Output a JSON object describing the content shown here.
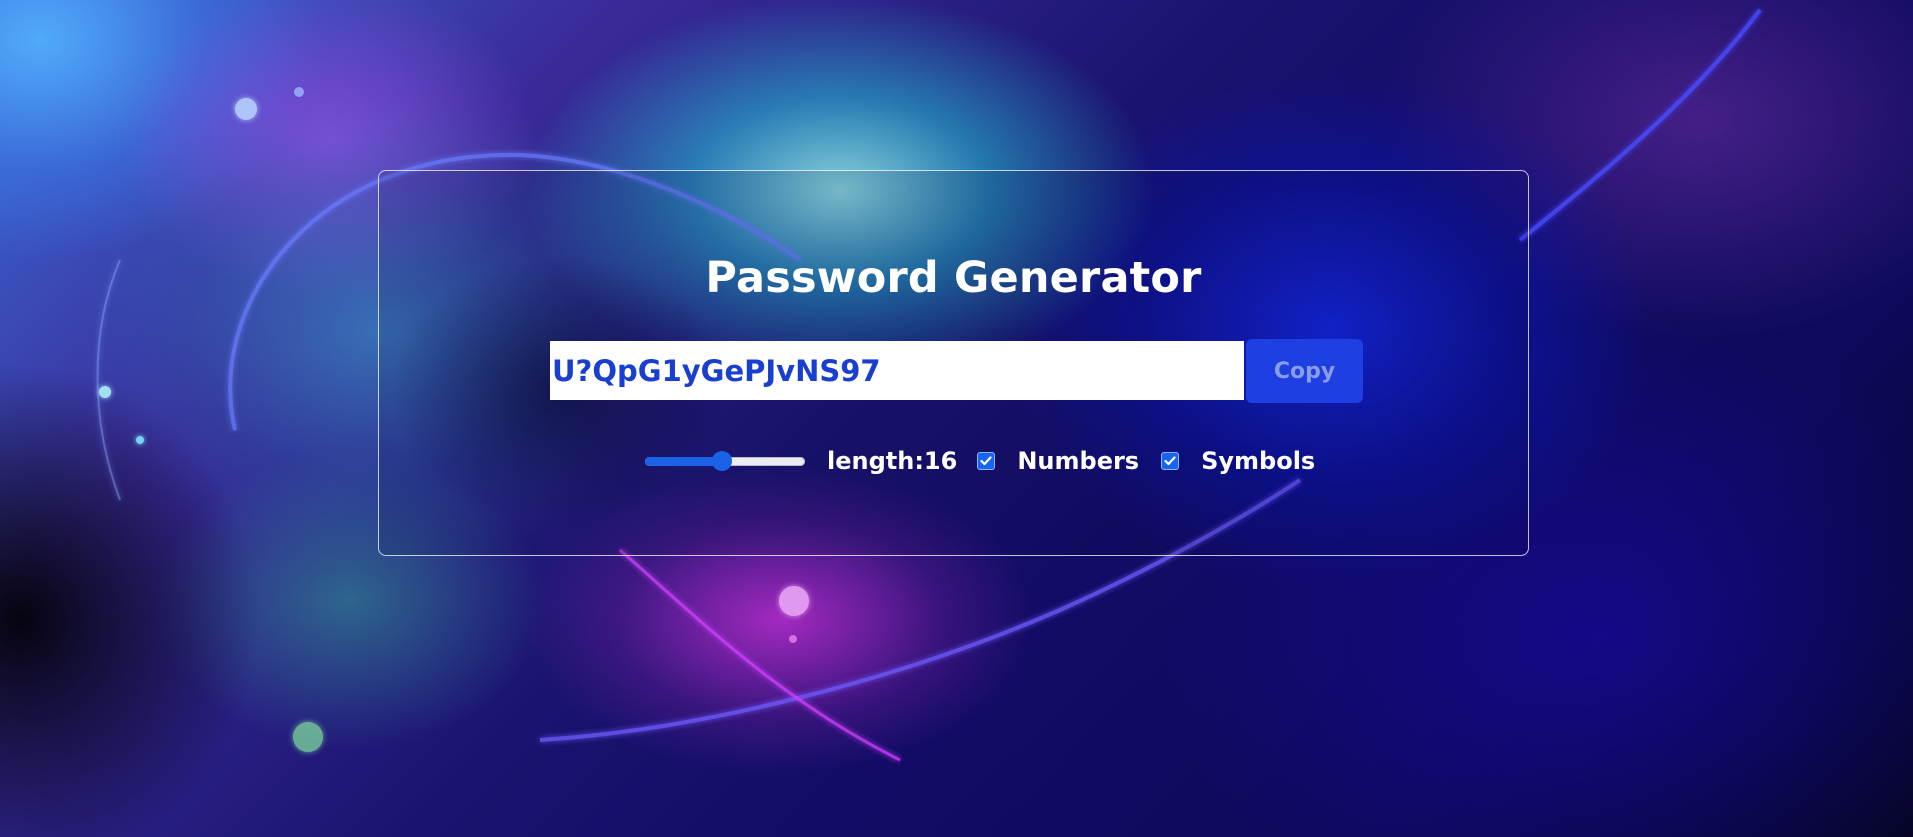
{
  "app": {
    "title": "Password Generator"
  },
  "password": {
    "value": "U?QpG1yGePJvNS97"
  },
  "copy_button": {
    "label": "Copy"
  },
  "length_slider": {
    "value_fraction": 0.48
  },
  "length_label": {
    "text": "length:16"
  },
  "options": [
    {
      "label": "Numbers",
      "checked": true
    },
    {
      "label": "Symbols",
      "checked": true
    }
  ],
  "colors": {
    "accent": "#1e3fe2",
    "password_text": "#1a3fd0",
    "checkbox": "#1766f0"
  }
}
